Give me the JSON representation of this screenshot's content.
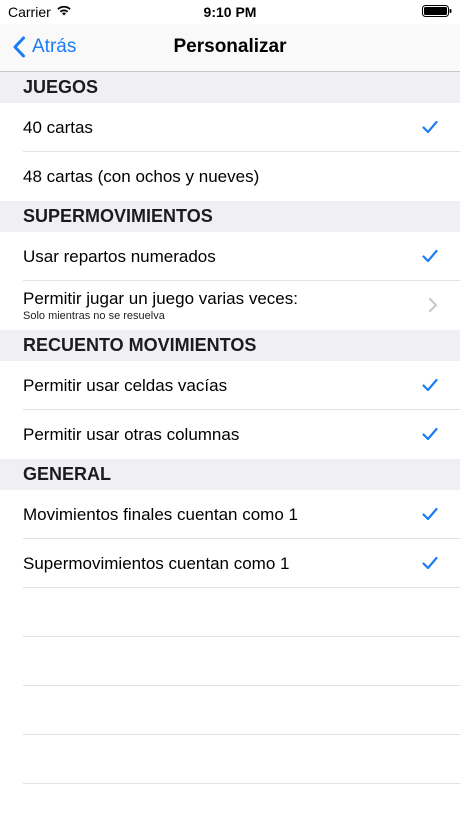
{
  "status_bar": {
    "carrier": "Carrier",
    "time": "9:10 PM"
  },
  "nav": {
    "back_label": "Atrás",
    "title": "Personalizar"
  },
  "sections": [
    {
      "title": "JUEGOS",
      "rows": [
        {
          "label": "40 cartas",
          "accessory": "checkmark"
        },
        {
          "label": "48 cartas (con ochos y nueves)",
          "accessory": "none"
        }
      ]
    },
    {
      "title": "SUPERMOVIMIENTOS",
      "rows": [
        {
          "label": "Usar repartos numerados",
          "accessory": "checkmark"
        },
        {
          "label": "Permitir jugar un juego varias veces:",
          "subtitle": "Solo mientras no se resuelva",
          "accessory": "chevron"
        }
      ]
    },
    {
      "title": "RECUENTO MOVIMIENTOS",
      "rows": [
        {
          "label": "Permitir usar celdas vacías",
          "accessory": "checkmark"
        },
        {
          "label": "Permitir usar otras columnas",
          "accessory": "checkmark"
        }
      ]
    },
    {
      "title": "GENERAL",
      "rows": [
        {
          "label": "Movimientos finales cuentan como 1",
          "accessory": "checkmark"
        },
        {
          "label": "Supermovimientos cuentan como 1",
          "accessory": "checkmark"
        }
      ]
    }
  ],
  "colors": {
    "accent": "#1b7cf6",
    "section_bg": "#efeff4",
    "chevron": "#c7c7cc"
  }
}
